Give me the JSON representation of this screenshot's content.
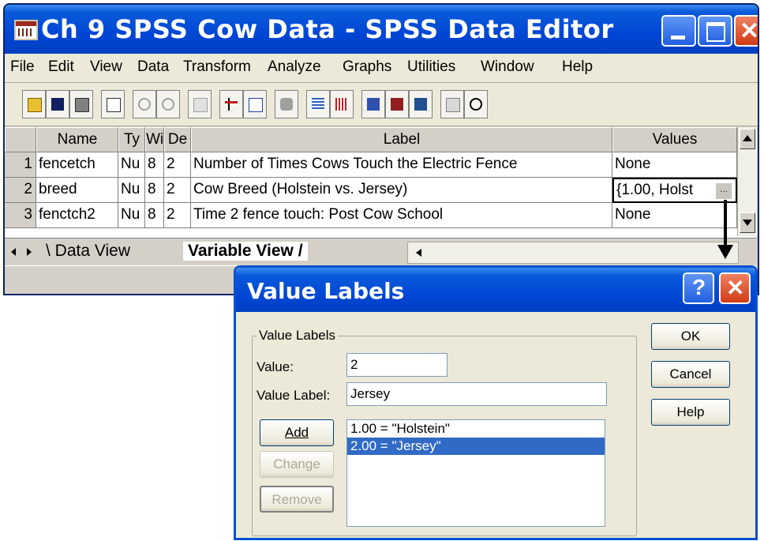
{
  "main_window": {
    "title": "Ch 9 SPSS Cow Data - SPSS Data Editor",
    "menu": [
      "File",
      "Edit",
      "View",
      "Data",
      "Transform",
      "Analyze",
      "Graphs",
      "Utilities",
      "Window",
      "Help"
    ],
    "columns": [
      "Name",
      "Ty",
      "Wi",
      "De",
      "Label",
      "Values"
    ],
    "rows": [
      {
        "num": "1",
        "name": "fencetch",
        "type": "Nu",
        "width": "8",
        "decimals": "2",
        "label": "Number of Times Cows Touch the Electric Fence",
        "values": "None"
      },
      {
        "num": "2",
        "name": "breed",
        "type": "Nu",
        "width": "8",
        "decimals": "2",
        "label": "Cow Breed (Holstein vs. Jersey)",
        "values": "{1.00, Holst"
      },
      {
        "num": "3",
        "name": "fenctch2",
        "type": "Nu",
        "width": "8",
        "decimals": "2",
        "label": "Time 2 fence touch: Post Cow School",
        "values": "None"
      }
    ],
    "tabs": {
      "data_view": "Data View",
      "variable_view": "Variable View"
    },
    "ellipsis": "..."
  },
  "dialog": {
    "title": "Value Labels",
    "group_label": "Value Labels",
    "value_label": "Value:",
    "value": "2",
    "value_label_label": "Value Label:",
    "value_label_value": "Jersey",
    "buttons": {
      "add": "Add",
      "change": "Change",
      "remove": "Remove",
      "ok": "OK",
      "cancel": "Cancel",
      "help": "Help"
    },
    "list": [
      "1.00 = \"Holstein\"",
      "2.00 = \"Jersey\""
    ],
    "selected_index": 1,
    "help_glyph": "?"
  },
  "colors": {
    "titlebar": "#0046d5",
    "selection": "#316ac5",
    "window_bg": "#ece9d8"
  }
}
